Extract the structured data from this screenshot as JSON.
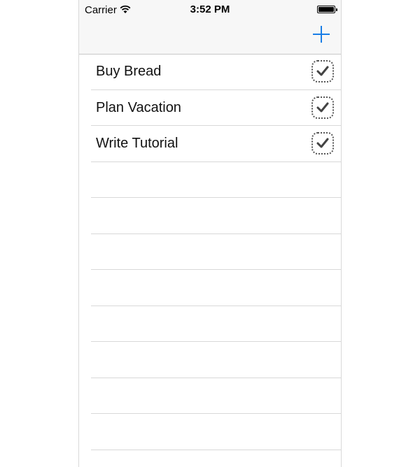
{
  "status_bar": {
    "carrier": "Carrier",
    "time": "3:52 PM"
  },
  "nav": {
    "add_icon": "plus-icon",
    "accent_color": "#1a7ee6"
  },
  "todos": [
    {
      "label": "Buy Bread",
      "icon": "check-icon"
    },
    {
      "label": "Plan Vacation",
      "icon": "check-icon"
    },
    {
      "label": "Write Tutorial",
      "icon": "check-icon"
    }
  ],
  "empty_rows": 8
}
